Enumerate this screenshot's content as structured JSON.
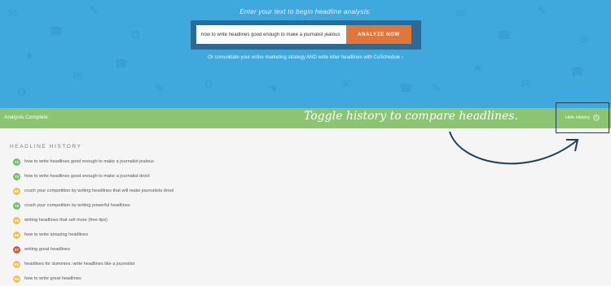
{
  "hero": {
    "prompt": "Enter your text to begin headline analysis:",
    "input_value": "how to write headlines good enough to make a journalist jealous",
    "analyze_label": "ANALYZE NOW",
    "cosched_link": "Or consolidate your entire marketing strategy AND write killer headlines with CoSchedule ›"
  },
  "status": {
    "text": "Analysis Complete",
    "callout": "Toggle history to compare headlines.",
    "hide_history_label": "Hide History"
  },
  "history": {
    "title": "HEADLINE HISTORY",
    "items": [
      {
        "score": "72",
        "color": "#6cc165",
        "text": "how to write headlines good enough to make a journalist jealous"
      },
      {
        "score": "70",
        "color": "#6cc165",
        "text": "how to write headlines good enough to make a journalist drool"
      },
      {
        "score": "69",
        "color": "#f0c24b",
        "text": "crush your competition by writing headlines that will make journalists drool"
      },
      {
        "score": "75",
        "color": "#6cc165",
        "text": "crush your competition by writing powerful headlines"
      },
      {
        "score": "48",
        "color": "#f0c24b",
        "text": "writing headlines that sell more (free tips)"
      },
      {
        "score": "59",
        "color": "#f0c24b",
        "text": "how to write amazing headlines"
      },
      {
        "score": "27",
        "color": "#c75a36",
        "text": "writing great headlines"
      },
      {
        "score": "53",
        "color": "#f0c24b",
        "text": "headlines for dummies: write headlines like a journalist"
      },
      {
        "score": "53",
        "color": "#f0c24b",
        "text": "how to write great headlines"
      }
    ]
  }
}
